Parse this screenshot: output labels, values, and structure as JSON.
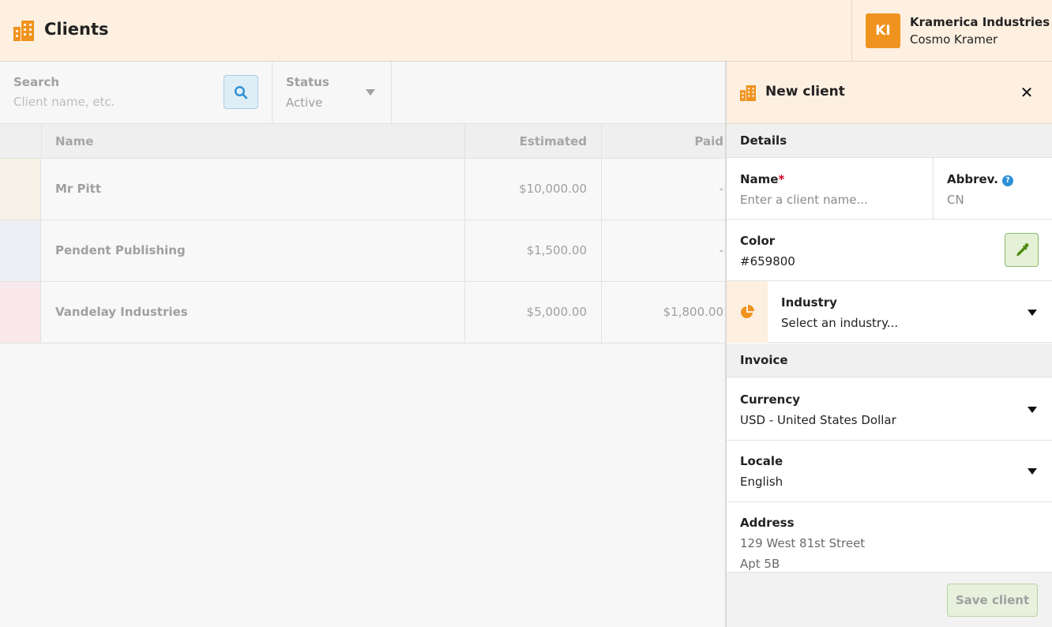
{
  "header": {
    "title": "Clients",
    "account": {
      "initials": "KI",
      "company": "Kramerica Industries",
      "user": "Cosmo Kramer"
    }
  },
  "filters": {
    "search": {
      "label": "Search",
      "placeholder": "Client name, etc."
    },
    "status": {
      "label": "Status",
      "value": "Active"
    }
  },
  "table": {
    "columns": [
      "Name",
      "Estimated",
      "Paid"
    ],
    "rows": [
      {
        "name": "Mr Pitt",
        "estimated": "$10,000.00",
        "paid": "-",
        "color": "#f6f0e6"
      },
      {
        "name": "Pendent Publishing",
        "estimated": "$1,500.00",
        "paid": "-",
        "color": "#eeeff5"
      },
      {
        "name": "Vandelay Industries",
        "estimated": "$5,000.00",
        "paid": "$1,800.00",
        "color": "#f8e8ec"
      }
    ]
  },
  "panel": {
    "title": "New client",
    "sections": {
      "details": "Details",
      "invoice": "Invoice"
    },
    "name": {
      "label": "Name",
      "required_mark": "*",
      "placeholder": "Enter a client name..."
    },
    "abbrev": {
      "label": "Abbrev.",
      "help": "?",
      "placeholder": "CN"
    },
    "color": {
      "label": "Color",
      "value": "#659800"
    },
    "industry": {
      "label": "Industry",
      "value": "Select an industry..."
    },
    "currency": {
      "label": "Currency",
      "value": "USD - United States Dollar"
    },
    "locale": {
      "label": "Locale",
      "value": "English"
    },
    "address": {
      "label": "Address",
      "line1": "129 West 81st Street",
      "line2": "Apt 5B"
    },
    "save_label": "Save client"
  },
  "colors": {
    "accent": "#f0931e",
    "header_bg": "#fdf0e1",
    "info": "#2c8fd6",
    "success": "#659800"
  }
}
